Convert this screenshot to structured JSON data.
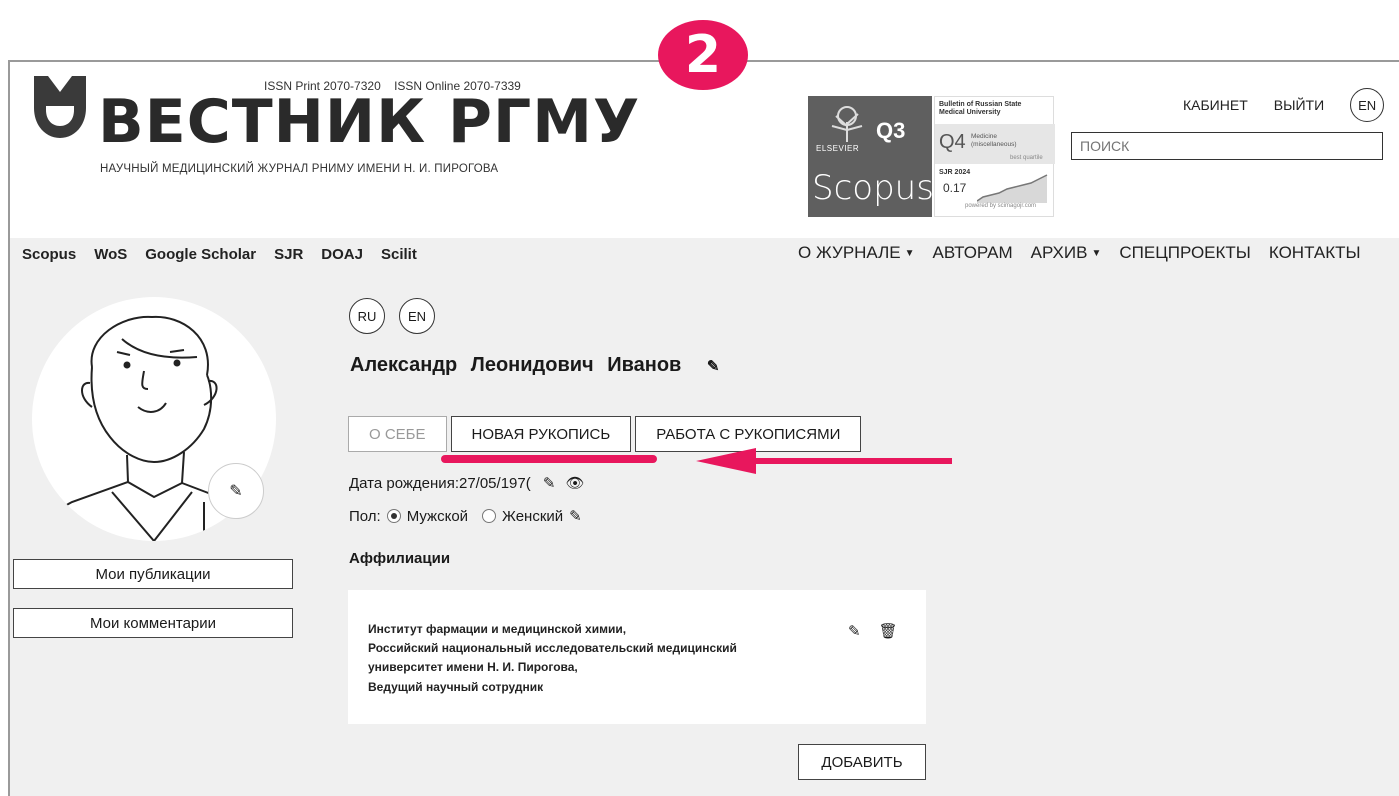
{
  "step_badge": "2",
  "header": {
    "issn_print": "ISSN Print 2070-7320",
    "issn_online": "ISSN Online 2070-7339",
    "logo_title": "ВЕСТНИК РГМУ",
    "logo_subtitle": "НАУЧНЫЙ МЕДИЦИНСКИЙ ЖУРНАЛ РНИМУ ИМЕНИ Н. И. ПИРОГОВА"
  },
  "scopus_badge": {
    "quartile": "Q3",
    "publisher": "ELSEVIER",
    "word": "Scopus",
    "brand_symbol": "®"
  },
  "sjr_badge": {
    "journal": "Bulletin of Russian State Medical University",
    "quartile": "Q4",
    "category_line1": "Medicine",
    "category_line2": "(miscellaneous)",
    "best_quartile": "best quartile",
    "year": "SJR 2024",
    "value": "0.17",
    "powered": "powered by scimagojr.com"
  },
  "top_links": {
    "cabinet": "КАБИНЕТ",
    "logout": "ВЫЙТИ",
    "lang": "EN"
  },
  "search": {
    "placeholder": "ПОИСК"
  },
  "indexes": [
    "Scopus",
    "WoS",
    "Google Scholar",
    "SJR",
    "DOAJ",
    "Scilit"
  ],
  "nav": {
    "about": "О ЖУРНАЛЕ",
    "authors": "АВТОРАМ",
    "archive": "АРХИВ",
    "special": "СПЕЦПРОЕКТЫ",
    "contacts": "КОНТАКТЫ"
  },
  "sidebar": {
    "publications": "Мои публикации",
    "comments": "Мои комментарии"
  },
  "profile": {
    "lang_ru": "RU",
    "lang_en": "EN",
    "name": "Александр Леонидович Иванов",
    "tabs": {
      "about": "О СЕБЕ",
      "new_manuscript": "НОВАЯ РУКОПИСЬ",
      "manuscripts": "РАБОТА С РУКОПИСЯМИ"
    },
    "dob_label": "Дата рождения:",
    "dob_value": "27/05/197(",
    "gender_label": "Пол:",
    "gender_male": "Мужской",
    "gender_female": "Женский",
    "affiliations_title": "Аффилиации",
    "affiliation_lines": [
      "Институт фармации и медицинской химии,",
      "Российский национальный исследовательский медицинский",
      "университет имени Н. И. Пирогова,",
      "Ведущий научный сотрудник"
    ],
    "add_button": "ДОБАВИТЬ"
  },
  "colors": {
    "accent": "#e8175d",
    "badge_gray": "#5f5f5f",
    "background": "#f0f0f0"
  }
}
